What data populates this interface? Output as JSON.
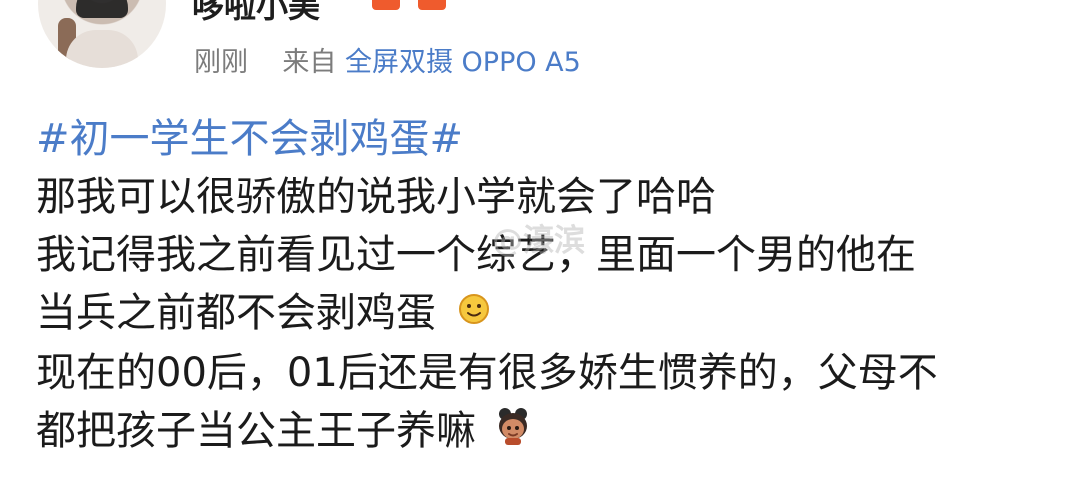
{
  "post": {
    "username": "哆啦小美",
    "time": "刚刚",
    "from_label": "来自",
    "source": "全屏双摄 OPPO A5",
    "topic": "#初一学生不会剥鸡蛋#",
    "lines": [
      "那我可以很骄傲的说我小学就会了哈哈",
      "我记得我之前看见过一个综艺，里面一个男的他在",
      "当兵之前都不会剥鸡蛋",
      "现在的00后，01后还是有很多娇生惯养的，父母不",
      "都把孩子当公主王子养嘛"
    ],
    "watermark": "@濠滨"
  },
  "icons": {
    "avatar": "avatar-photo",
    "sun_emoji": "sun-emoji-icon",
    "doll_emoji": "doll-emoji-icon"
  }
}
